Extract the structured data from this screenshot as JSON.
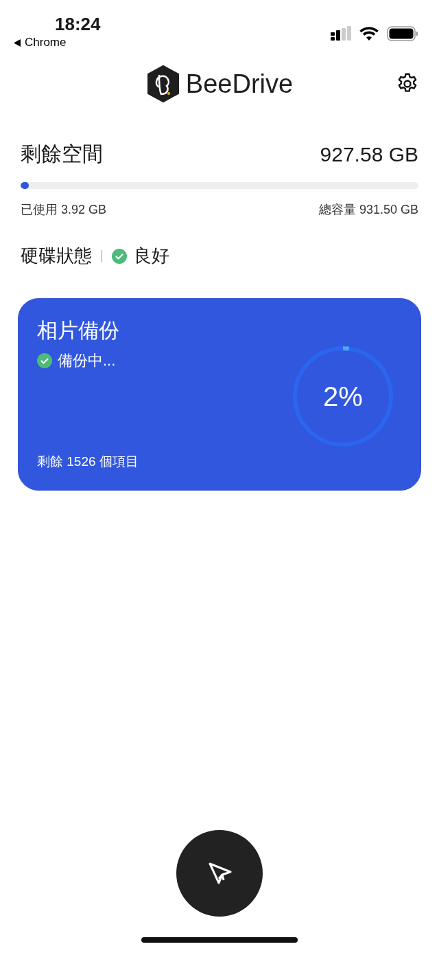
{
  "status_bar": {
    "time": "18:24",
    "back_label": "Chrome"
  },
  "header": {
    "app_name": "BeeDrive"
  },
  "storage": {
    "title": "剩餘空間",
    "free": "927.58 GB",
    "level": 0.004,
    "used": "已使用 3.92 GB",
    "total": "總容量 931.50 GB"
  },
  "disk_status": {
    "label": "硬碟狀態",
    "value": "良好",
    "healthy": true
  },
  "backup_card": {
    "title": "相片備份",
    "status": "備份中...",
    "status_ok": true,
    "level": 0.02,
    "percent": "2%",
    "remaining": "剩餘 1526 個項目"
  }
}
